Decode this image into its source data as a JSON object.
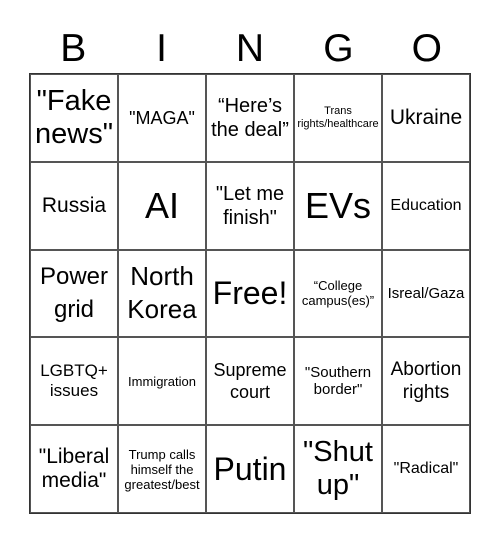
{
  "title_letters": [
    "B",
    "I",
    "N",
    "G",
    "O"
  ],
  "cells": [
    {
      "text": "\"Fake news\"",
      "size": "s29"
    },
    {
      "text": "\"MAGA\"",
      "size": "s18"
    },
    {
      "text": "“Here’s the deal”",
      "size": "s20"
    },
    {
      "text": "Trans rights/healthcare",
      "size": "s11"
    },
    {
      "text": "Ukraine",
      "size": "s21"
    },
    {
      "text": "Russia",
      "size": "s21"
    },
    {
      "text": "AI",
      "size": "s36"
    },
    {
      "text": "\"Let me finish\"",
      "size": "s20"
    },
    {
      "text": "EVs",
      "size": "s36"
    },
    {
      "text": "Education",
      "size": "s16"
    },
    {
      "text": "Power grid",
      "size": "s24"
    },
    {
      "text": "North Korea",
      "size": "s26"
    },
    {
      "text": "Free!",
      "size": "s32"
    },
    {
      "text": "“College campus(es)”",
      "size": "s13"
    },
    {
      "text": "Isreal/Gaza",
      "size": "s15"
    },
    {
      "text": "LGBTQ+ issues",
      "size": "s17"
    },
    {
      "text": "Immigration",
      "size": "s13"
    },
    {
      "text": "Supreme court",
      "size": "s18"
    },
    {
      "text": "\"Southern border\"",
      "size": "s15"
    },
    {
      "text": "Abortion rights",
      "size": "s19"
    },
    {
      "text": "\"Liberal media\"",
      "size": "s21"
    },
    {
      "text": "Trump calls himself the greatest/best",
      "size": "s13"
    },
    {
      "text": "Putin",
      "size": "s32"
    },
    {
      "text": "\"Shut up\"",
      "size": "s29"
    },
    {
      "text": "\"Radical\"",
      "size": "s16"
    }
  ]
}
